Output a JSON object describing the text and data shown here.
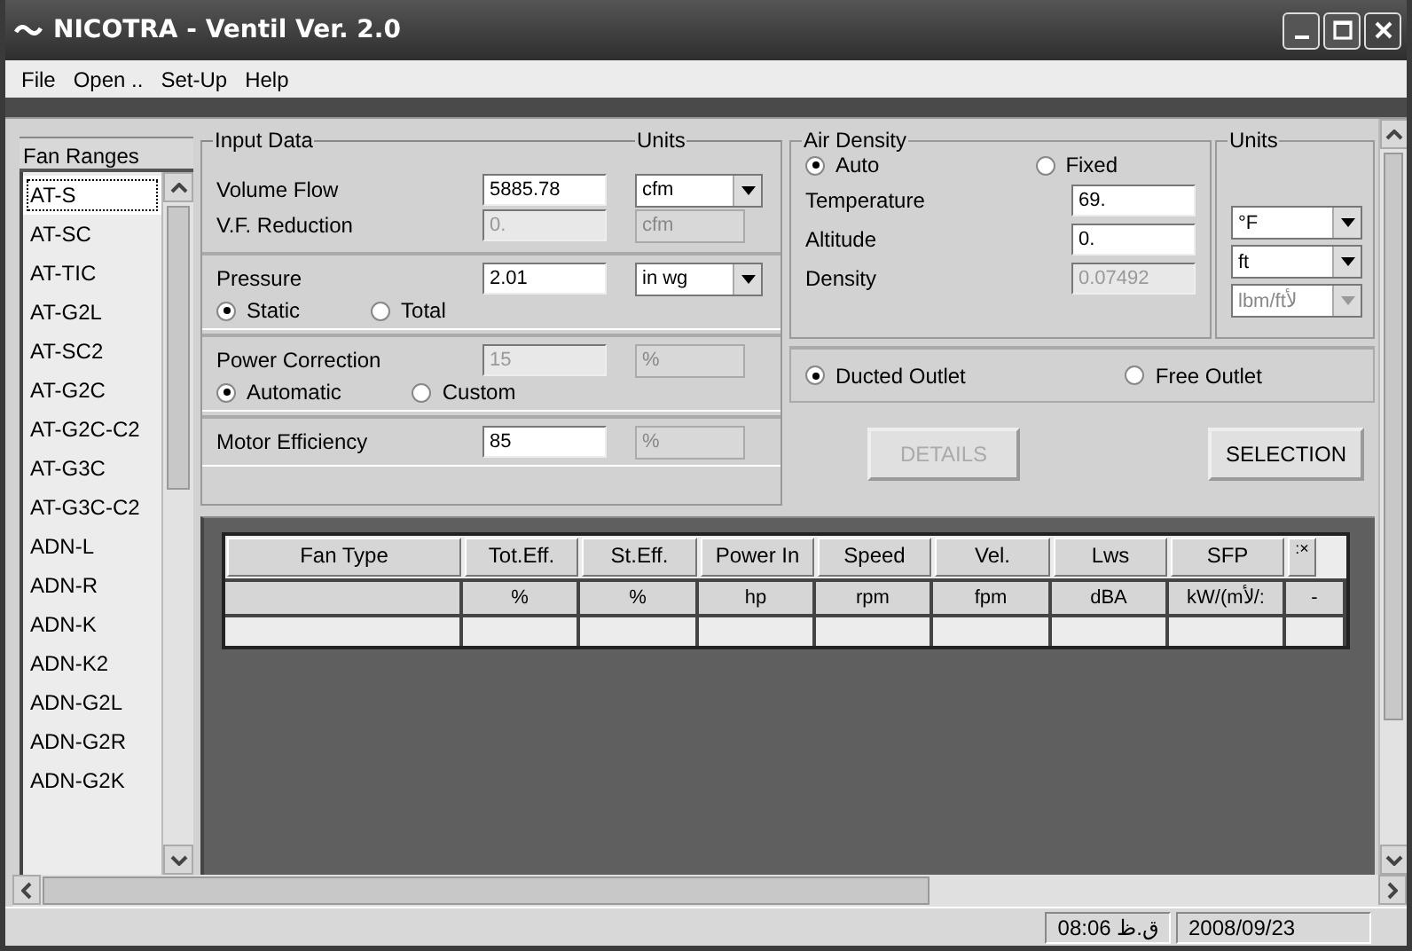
{
  "window": {
    "title": "NICOTRA - Ventil Ver. 2.0"
  },
  "menu": [
    {
      "label": "File"
    },
    {
      "label": "Open .."
    },
    {
      "label": "Set-Up"
    },
    {
      "label": "Help"
    }
  ],
  "fan_ranges": {
    "title": "Fan Ranges",
    "items": [
      {
        "label": "AT-S",
        "selected": true
      },
      {
        "label": "AT-SC",
        "selected": false
      },
      {
        "label": "AT-TIC",
        "selected": false
      },
      {
        "label": "AT-G2L",
        "selected": false
      },
      {
        "label": "AT-SC2",
        "selected": false
      },
      {
        "label": "AT-G2C",
        "selected": false
      },
      {
        "label": "AT-G2C-C2",
        "selected": false
      },
      {
        "label": "AT-G3C",
        "selected": false
      },
      {
        "label": "AT-G3C-C2",
        "selected": false
      },
      {
        "label": "ADN-L",
        "selected": false
      },
      {
        "label": "ADN-R",
        "selected": false
      },
      {
        "label": "ADN-K",
        "selected": false
      },
      {
        "label": "ADN-K2",
        "selected": false
      },
      {
        "label": "ADN-G2L",
        "selected": false
      },
      {
        "label": "ADN-G2R",
        "selected": false
      },
      {
        "label": "ADN-G2K",
        "selected": false
      }
    ]
  },
  "input_data": {
    "title": "Input Data",
    "units_title": "Units",
    "sections": [
      {
        "fields": [
          {
            "label": "Volume Flow",
            "value": "5885.78",
            "disabled": false,
            "unit": {
              "kind": "dropdown",
              "value": "cfm",
              "disabled": false
            }
          },
          {
            "label": "V.F. Reduction",
            "value": "0.",
            "disabled": true,
            "unit": {
              "kind": "box",
              "value": "cfm",
              "disabled": true
            }
          }
        ]
      },
      {
        "fields": [
          {
            "label": "Pressure",
            "value": "2.01",
            "disabled": false,
            "unit": {
              "kind": "dropdown",
              "value": "in wg",
              "disabled": false
            }
          }
        ],
        "radios": [
          {
            "label": "Static",
            "selected": true
          },
          {
            "label": "Total",
            "selected": false
          }
        ]
      },
      {
        "fields": [
          {
            "label": "Power Correction",
            "value": "15",
            "disabled": true,
            "unit": {
              "kind": "box",
              "value": "%",
              "disabled": true
            }
          }
        ],
        "radios": [
          {
            "label": "Automatic",
            "selected": true
          },
          {
            "label": "Custom",
            "selected": false
          }
        ]
      },
      {
        "fields": [
          {
            "label": "Motor Efficiency",
            "value": "85",
            "disabled": false,
            "unit": {
              "kind": "box",
              "value": "%",
              "disabled": true
            }
          }
        ]
      }
    ]
  },
  "air_density": {
    "title": "Air Density",
    "units_title": "Units",
    "radios": [
      {
        "label": "Auto",
        "selected": true
      },
      {
        "label": "Fixed",
        "selected": false
      }
    ],
    "fields": [
      {
        "label": "Temperature",
        "value": "69.",
        "disabled": false,
        "unit": {
          "kind": "dropdown",
          "value": "°F",
          "disabled": false
        }
      },
      {
        "label": "Altitude",
        "value": "0.",
        "disabled": false,
        "unit": {
          "kind": "dropdown",
          "value": "ft",
          "disabled": false
        }
      },
      {
        "label": "Density",
        "value": "0.07492",
        "disabled": true,
        "unit": {
          "kind": "dropdown",
          "value": "lbm/ftﻷ",
          "disabled": true
        }
      }
    ]
  },
  "outlet": [
    {
      "label": "Ducted Outlet",
      "selected": true
    },
    {
      "label": "Free Outlet",
      "selected": false
    }
  ],
  "buttons": [
    {
      "label": "DETAILS",
      "disabled": true
    },
    {
      "label": "SELECTION",
      "disabled": false
    }
  ],
  "table": {
    "columns": [
      {
        "name": "Fan Type"
      },
      {
        "name": "Tot.Eff.",
        "unit": "%"
      },
      {
        "name": "St.Eff.",
        "unit": "%"
      },
      {
        "name": "Power In",
        "unit": "hp"
      },
      {
        "name": "Speed",
        "unit": "rpm"
      },
      {
        "name": "Vel.",
        "unit": "fpm"
      },
      {
        "name": "Lws",
        "unit": "dBA"
      },
      {
        "name": "SFP",
        "unit": "kW/(mﻷ/:"
      },
      {
        "name": ":×",
        "unit": "-"
      }
    ]
  },
  "status_bar": {
    "time": "08:06 ق.ظ",
    "date": "2008/09/23"
  }
}
